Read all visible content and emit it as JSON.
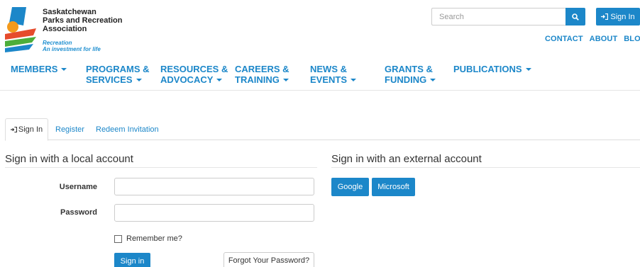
{
  "brand": {
    "name_lines": [
      "Saskatchewan",
      "Parks and Recreation",
      "Association"
    ],
    "tagline_lines": [
      "Recreation",
      "An investment for life"
    ],
    "colors": {
      "blue": "#1c87c9",
      "orange": "#f39a1c",
      "green": "#4cae3a",
      "red": "#e64b2c"
    }
  },
  "header": {
    "search_placeholder": "Search",
    "search_icon": "search-icon",
    "signin_label": "Sign In",
    "signin_icon": "sign-in-icon",
    "links": [
      "CONTACT",
      "ABOUT",
      "BLOG"
    ]
  },
  "nav": {
    "items": [
      {
        "lines": [
          "MEMBERS"
        ],
        "dropdown": true
      },
      {
        "lines": [
          "PROGRAMS &",
          "SERVICES"
        ],
        "dropdown": true
      },
      {
        "lines": [
          "RESOURCES &",
          "ADVOCACY"
        ],
        "dropdown": true
      },
      {
        "lines": [
          "CAREERS &",
          "TRAINING"
        ],
        "dropdown": true
      },
      {
        "lines": [
          "NEWS &",
          "EVENTS"
        ],
        "dropdown": true
      },
      {
        "lines": [
          "GRANTS &",
          "FUNDING"
        ],
        "dropdown": true
      },
      {
        "lines": [
          "PUBLICATIONS"
        ],
        "dropdown": true
      }
    ]
  },
  "tabs": {
    "signin": "Sign In",
    "register": "Register",
    "redeem": "Redeem Invitation"
  },
  "local": {
    "title": "Sign in with a local account",
    "username_label": "Username",
    "username_value": "",
    "password_label": "Password",
    "password_value": "",
    "remember_label": "Remember me?",
    "remember_checked": false,
    "signin_button": "Sign in",
    "forgot_button": "Forgot Your Password?"
  },
  "external": {
    "title": "Sign in with an external account",
    "providers": [
      "Google",
      "Microsoft"
    ]
  }
}
